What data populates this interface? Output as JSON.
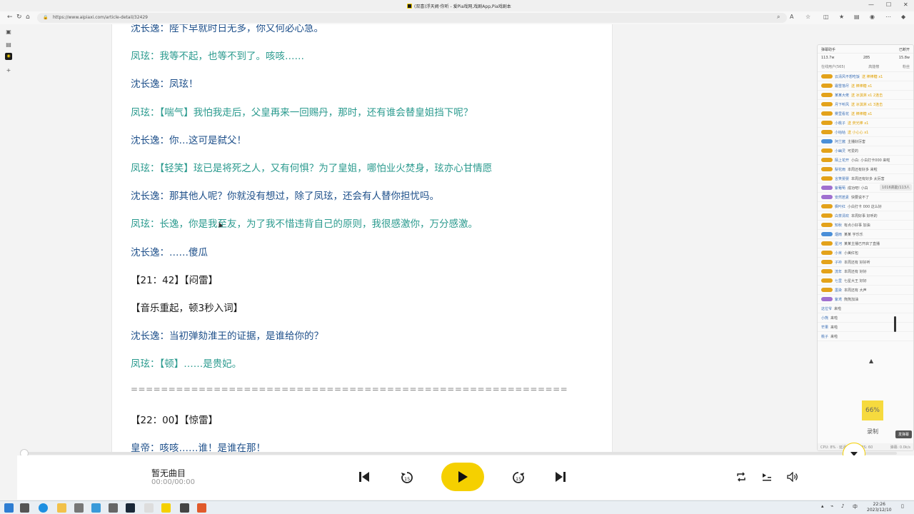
{
  "browser": {
    "window_title": "(双喜)浮天阙·你听 - 爱Pia戏网,戏剧App,Pia戏剧本",
    "url": "https://www.aipiaxi.com/article-detail/32429"
  },
  "article": {
    "lines": [
      {
        "text": "沈长逸：陛下早就时日无多，你又何必心急。",
        "style": "blue"
      },
      {
        "text": "凤玹：我等不起，也等不到了。咳咳……",
        "style": "teal"
      },
      {
        "text": "沈长逸：凤玹！",
        "style": "blue"
      },
      {
        "text": "凤玹：【喘气】我怕我走后，父皇再来一回赐丹，那时，还有谁会替皇姐挡下呢？",
        "style": "teal"
      },
      {
        "text": "沈长逸：你…这可是弑父！",
        "style": "blue"
      },
      {
        "text": "凤玹：【轻笑】玹已是将死之人，又有何惧？为了皇姐，哪怕业火焚身，玹亦心甘情愿",
        "style": "teal"
      },
      {
        "text": "沈长逸：那其他人呢？你就没有想过，除了凤玹，还会有人替你担忧吗。",
        "style": "blue"
      },
      {
        "text": "凤玹：长逸，你是我至友，为了我不惜违背自己的原则，我很感激你，万分感激。",
        "style": "teal"
      },
      {
        "text": "沈长逸：……傻瓜",
        "style": "blue"
      },
      {
        "text": "【21：42】【闷雷】",
        "style": "black"
      },
      {
        "text": "【音乐重起，顿3秒入词】",
        "style": "black"
      },
      {
        "text": "沈长逸：当初弹劾淮王的证据，是谁给你的？",
        "style": "blue"
      },
      {
        "text": "凤玹：【顿】……是贵妃。",
        "style": "teal"
      },
      {
        "text": "==========================================================",
        "style": "sep"
      },
      {
        "text": "【22：00】【惊雷】",
        "style": "black"
      },
      {
        "text": "皇帝：咳咳……谁！是谁在那！",
        "style": "blue"
      }
    ]
  },
  "live_panel": {
    "title": "弹幕助手",
    "status": "已断开",
    "stats": {
      "viewers": "113.7w",
      "fans": "285",
      "likes": "15.8w"
    },
    "tabs": [
      "在线用户(565)",
      "高能榜",
      "粉丝"
    ],
    "online_count": "1016高能/113人",
    "volume_pct": "66%",
    "record_label": "录制",
    "comment_label": "发弹幕",
    "footer_left": "CPU: 8% · 延迟: 0k/s · FPS: 60",
    "footer_right": "弹幕: 0.0k/s",
    "rows": [
      {
        "name": "云清风不想吃饭",
        "msg": "送 棒棒糖 x1",
        "badge": "gold"
      },
      {
        "name": "霜雪落尽",
        "msg": "送 棒棒糖 x1",
        "badge": "gold"
      },
      {
        "name": "某某大佬",
        "msg": "送 冰淇淋 x1 2连击",
        "badge": "gold"
      },
      {
        "name": "月下听风",
        "msg": "送 冰淇淋 x1 3连击",
        "badge": "gold"
      },
      {
        "name": "雾里看花",
        "msg": "送 棒棒糖 x1",
        "badge": "gold"
      },
      {
        "name": "小桃子",
        "msg": "送 荧光棒 x1",
        "badge": "gold"
      },
      {
        "name": "小咕咕",
        "msg": "送 小心心 x1",
        "badge": "gold"
      },
      {
        "name": "阿兰酱",
        "msg": "主播好厉害",
        "badge": "blue"
      },
      {
        "name": "小幽灵",
        "msg": "可爱的",
        "badge": "gold"
      },
      {
        "name": "陌上花开",
        "msg": "小白: 小白打卡000 来啦",
        "badge": "gold"
      },
      {
        "name": "梨花雨",
        "msg": "本周还有好多 来啦",
        "badge": "gold"
      },
      {
        "name": "言笑晏晏",
        "msg": "本周还有好多 太厉害",
        "badge": "gold"
      },
      {
        "name": "紫葡萄",
        "msg": "成功吧! 小白",
        "badge": "purple"
      },
      {
        "name": "安然若素",
        "msg": "快要说不了",
        "badge": "purple"
      },
      {
        "name": "枫叶红",
        "msg": "小白打卡 000 这么好",
        "badge": "gold"
      },
      {
        "name": "白茶清欢",
        "msg": "本周好事 好听的",
        "badge": "gold"
      },
      {
        "name": "知秋",
        "msg": "有点小好事 加油",
        "badge": "gold"
      },
      {
        "name": "烟雨",
        "msg": "某某 宇乐乐",
        "badge": "blue"
      },
      {
        "name": "星河",
        "msg": "某某主播已开启了直播",
        "badge": "gold"
      },
      {
        "name": "小米",
        "msg": "小美红包",
        "badge": "gold"
      },
      {
        "name": "子衿",
        "msg": "本周还有 好好听",
        "badge": "gold"
      },
      {
        "name": "流年",
        "msg": "本周还有 好好",
        "badge": "gold"
      },
      {
        "name": "七里",
        "msg": "七星大王 好好",
        "badge": "gold"
      },
      {
        "name": "墨染",
        "msg": "本周还有 大声",
        "badge": "gold"
      },
      {
        "name": "紫鸢",
        "msg": "熊熊加油",
        "badge": "purple"
      },
      {
        "name": "这位爷",
        "msg": "来啦",
        "badge": "none"
      },
      {
        "name": "小熊",
        "msg": "来啦",
        "badge": "none"
      },
      {
        "name": "芒果",
        "msg": "来啦",
        "badge": "none"
      },
      {
        "name": "桃子",
        "msg": "来啦",
        "badge": "none"
      }
    ]
  },
  "player": {
    "track_title": "暂无曲目",
    "track_time": "00:00/00:00",
    "progress": 0
  },
  "taskbar": {
    "ime_label": "中",
    "time": "22:26",
    "date": "2023/12/10"
  }
}
